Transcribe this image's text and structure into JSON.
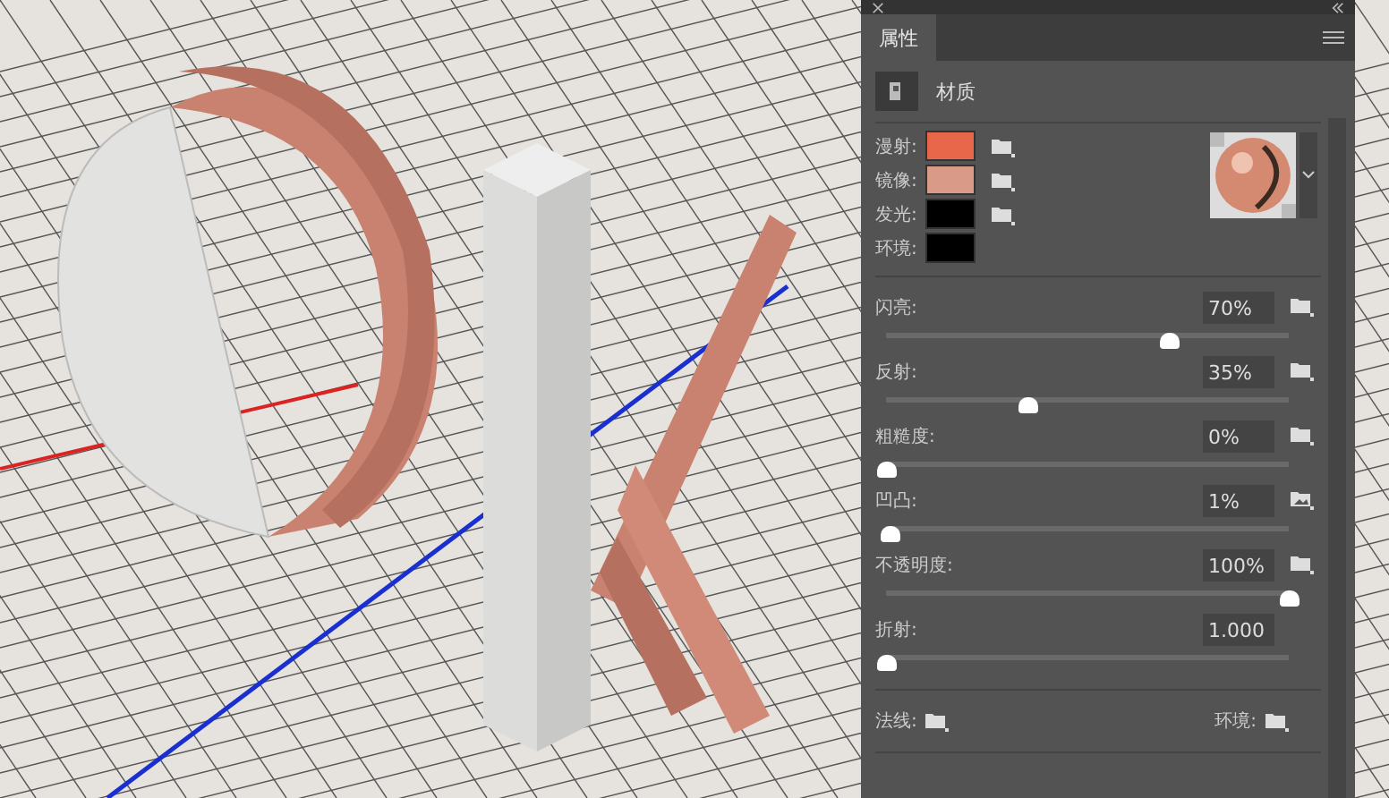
{
  "tabs": [
    {
      "label": "属性",
      "selected": true
    }
  ],
  "section": {
    "label": "材质"
  },
  "colors": [
    {
      "label": "漫射:",
      "color": "#e8674a",
      "texture": true
    },
    {
      "label": "镜像:",
      "color": "#d99a88",
      "texture": true
    },
    {
      "label": "发光:",
      "color": "#000000",
      "texture": true
    },
    {
      "label": "环境:",
      "color": "#000000",
      "texture": false
    }
  ],
  "sliders": [
    {
      "label": "闪亮:",
      "value": "70%",
      "level": 0.7,
      "kind": "folder"
    },
    {
      "label": "反射:",
      "value": "35%",
      "level": 0.35,
      "kind": "folder"
    },
    {
      "label": "粗糙度:",
      "value": "0%",
      "level": 0,
      "kind": "folder"
    },
    {
      "label": "凹凸:",
      "value": "1%",
      "level": 0.01,
      "kind": "bump"
    },
    {
      "label": "不透明度:",
      "value": "100%",
      "level": 1,
      "kind": "folder"
    },
    {
      "label": "折射:",
      "value": "1.000",
      "level": 0,
      "kind": "none"
    }
  ],
  "maps": [
    {
      "label": "法线:"
    },
    {
      "label": "环境:"
    }
  ]
}
